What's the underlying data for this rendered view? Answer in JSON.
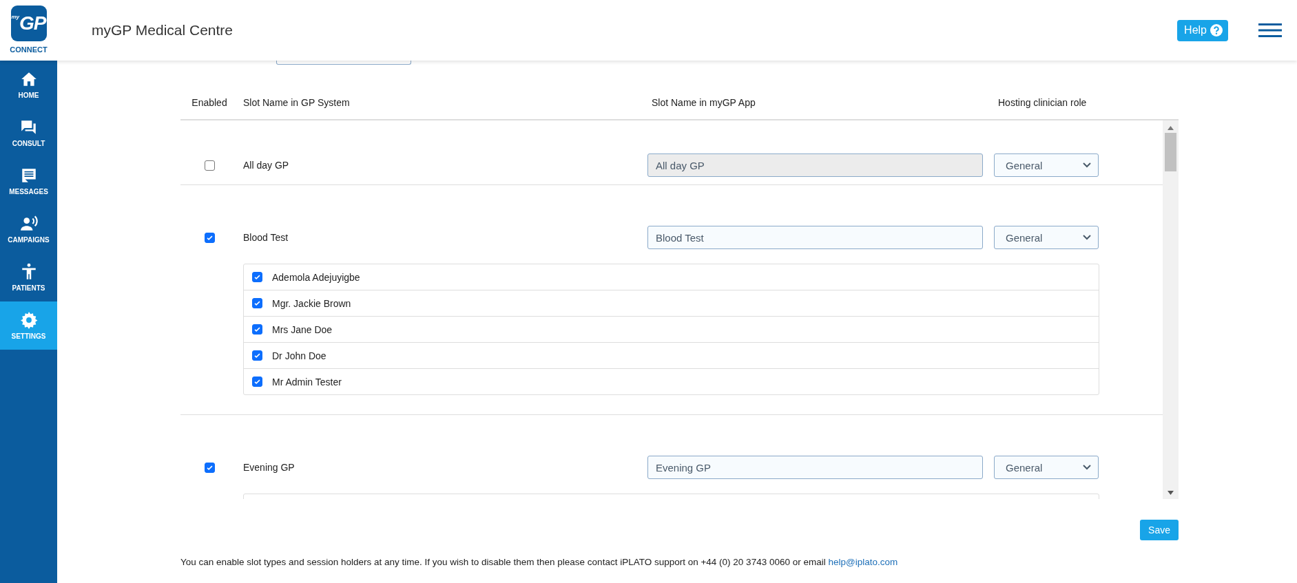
{
  "header": {
    "logo_prefix": "my",
    "logo": "GP",
    "logo_caption": "CONNECT",
    "title": "myGP Medical Centre",
    "help_button": "Help"
  },
  "sidebar": {
    "items": [
      {
        "label": "HOME",
        "selected": false
      },
      {
        "label": "CONSULT",
        "selected": false
      },
      {
        "label": "MESSAGES",
        "selected": false
      },
      {
        "label": "CAMPAIGNS",
        "selected": false
      },
      {
        "label": "PATIENTS",
        "selected": false
      },
      {
        "label": "SETTINGS",
        "selected": true
      }
    ]
  },
  "table": {
    "columns": [
      "Enabled",
      "Slot Name in GP System",
      "Slot Name in myGP App",
      "Hosting clinician role"
    ],
    "rows": [
      {
        "enabled": false,
        "slot_name": "All day GP",
        "app_name": "All day GP",
        "role": "General",
        "holders_expanded": false
      },
      {
        "enabled": true,
        "slot_name": "Blood Test",
        "app_name": "Blood Test",
        "role": "General",
        "holders_expanded": true,
        "session_holders": [
          {
            "name": "Ademola Adejuyigbe",
            "checked": true
          },
          {
            "name": "Mgr. Jackie Brown",
            "checked": true
          },
          {
            "name": "Mrs Jane Doe",
            "checked": true
          },
          {
            "name": "Dr John Doe",
            "checked": true
          },
          {
            "name": "Mr Admin Tester",
            "checked": true
          }
        ]
      },
      {
        "enabled": true,
        "slot_name": "Evening GP",
        "app_name": "Evening GP",
        "role": "General",
        "holders_expanded": true
      }
    ]
  },
  "save_button": "Save",
  "footer": {
    "text": "You can enable slot types and session holders at any time. If you wish to disable them then please contact iPLATO support on +44 (0) 20 3743 0060 or email ",
    "link": "help@iplato.com"
  }
}
